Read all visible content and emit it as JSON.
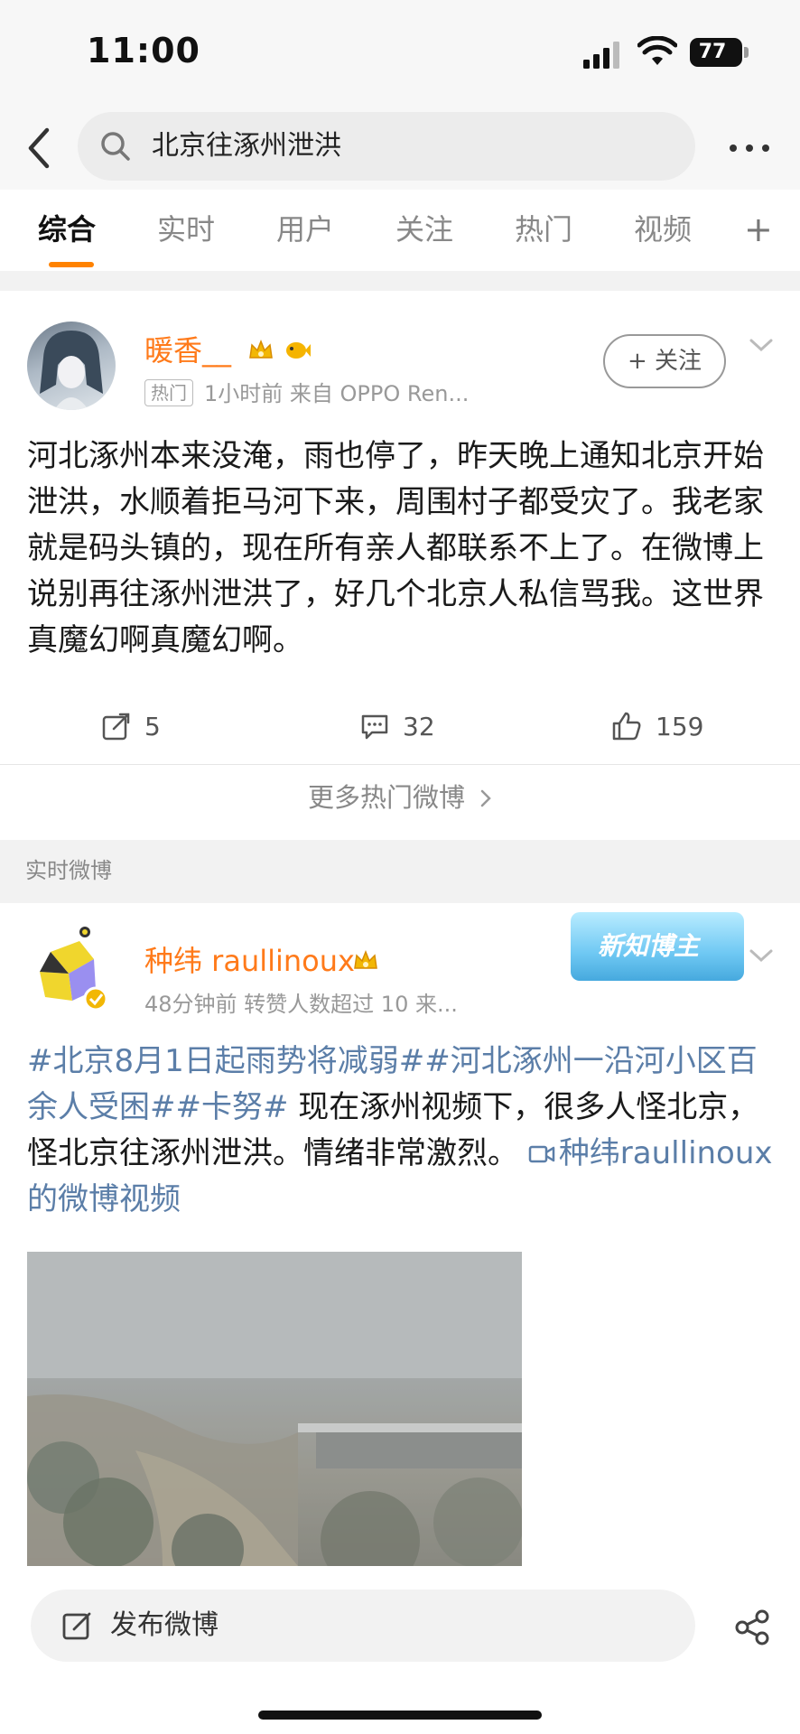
{
  "status_bar": {
    "time": "11:00",
    "battery": "77"
  },
  "search": {
    "query": "北京往涿州泄洪"
  },
  "tabs": [
    {
      "label": "综合"
    },
    {
      "label": "实时"
    },
    {
      "label": "用户"
    },
    {
      "label": "关注"
    },
    {
      "label": "热门"
    },
    {
      "label": "视频"
    }
  ],
  "tab_plus": "+",
  "post1": {
    "username": "暖香__",
    "hot_tag": "热门",
    "meta": "1小时前  来自 OPPO Ren...",
    "follow_label": "+ 关注",
    "text": "河北涿州本来没淹，雨也停了，昨天晚上通知北京开始泄洪，水顺着拒马河下来，周围村子都受灾了。我老家就是码头镇的，现在所有亲人都联系不上了。在微博上说别再往涿州泄洪了，好几个北京人私信骂我。这世界真魔幻啊真魔幻啊。",
    "reposts": "5",
    "comments": "32",
    "likes": "159"
  },
  "more_hot": "更多热门微博",
  "section_label": "实时微博",
  "post2": {
    "username": "种纬 raullinoux",
    "meta": "48分钟前  转赞人数超过 10  来...",
    "badge": "新知博主",
    "topic1": "#北京8月1日起雨势将减弱#",
    "topic2": "#河北涿州一沿河小区百余人受困#",
    "topic3": "#卡努#",
    "body": " 现在涿州视频下，很多人怪北京，怪北京往涿州泄洪。情绪非常激烈。 ",
    "video_link": "种纬raullinoux的微博视频"
  },
  "bottom": {
    "compose": "发布微博"
  },
  "colors": {
    "accent": "#ff8200",
    "username": "#ff7a1a",
    "link": "#5b7ea8"
  }
}
